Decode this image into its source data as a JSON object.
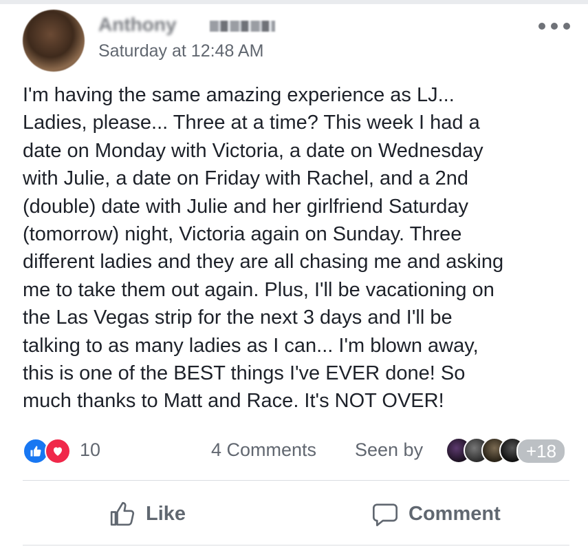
{
  "post": {
    "author_name": "Anthony",
    "timestamp": "Saturday at 12:48 AM",
    "body": "I'm having the same amazing experience as LJ...\nLadies, please... Three at a time? This week I had a\ndate on Monday with Victoria, a date on Wednesday\nwith Julie, a date on Friday with Rachel, and a 2nd\n(double) date with Julie and her girlfriend Saturday\n(tomorrow) night, Victoria again on Sunday. Three\ndifferent ladies and they are all chasing me and asking\nme to take them out again. Plus, I'll be vacationing on\nthe Las Vegas strip for the next 3 days and I'll be\ntalking to as many ladies as I can... I'm blown away,\nthis is one of the BEST things I've EVER done! So\nmuch thanks to Matt and Race. It's NOT OVER!"
  },
  "reactions": {
    "icons": [
      "like-icon",
      "love-icon"
    ],
    "count": "10",
    "like_color": "#1877f2",
    "love_color": "#f0284a"
  },
  "engagement": {
    "comments": "4 Comments",
    "seen_by_label": "Seen by",
    "seen_by_extra": "+18"
  },
  "actions": {
    "like_label": "Like",
    "comment_label": "Comment"
  }
}
